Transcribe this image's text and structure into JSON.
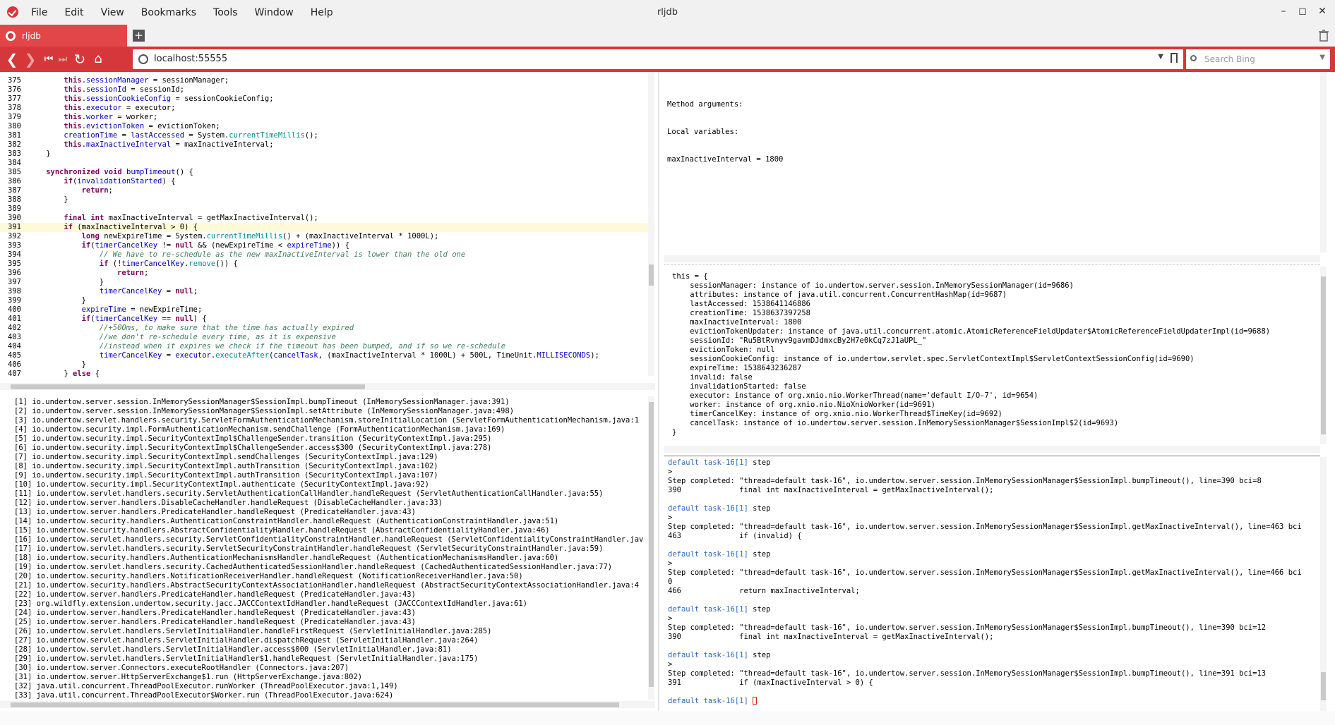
{
  "window": {
    "title": "rljdb"
  },
  "menu": [
    "File",
    "Edit",
    "View",
    "Bookmarks",
    "Tools",
    "Window",
    "Help"
  ],
  "tab": {
    "title": "rljdb"
  },
  "address": {
    "url": "localhost:55555",
    "search_placeholder": "Search Bing"
  },
  "code": {
    "highlight_line": 391,
    "lines": [
      {
        "n": "375",
        "html": "<span class=\"kw\">this</span>.<span class=\"fld\">sessionManager</span> = sessionManager;",
        "indent": 8
      },
      {
        "n": "376",
        "html": "<span class=\"kw\">this</span>.<span class=\"fld\">sessionId</span> = sessionId;",
        "indent": 8
      },
      {
        "n": "377",
        "html": "<span class=\"kw\">this</span>.<span class=\"fld\">sessionCookieConfig</span> = sessionCookieConfig;",
        "indent": 8
      },
      {
        "n": "378",
        "html": "<span class=\"kw\">this</span>.<span class=\"fld\">executor</span> = executor;",
        "indent": 8
      },
      {
        "n": "379",
        "html": "<span class=\"kw\">this</span>.<span class=\"fld\">worker</span> = worker;",
        "indent": 8
      },
      {
        "n": "380",
        "html": "<span class=\"kw\">this</span>.<span class=\"fld\">evictionToken</span> = evictionToken;",
        "indent": 8
      },
      {
        "n": "381",
        "html": "<span class=\"fld\">creationTime</span> = <span class=\"fld\">lastAccessed</span> = System.<span class=\"mt\">currentTimeMillis</span>();",
        "indent": 8
      },
      {
        "n": "382",
        "html": "<span class=\"kw\">this</span>.<span class=\"fld\">maxInactiveInterval</span> = maxInactiveInterval;",
        "indent": 8
      },
      {
        "n": "383",
        "html": "}",
        "indent": 4
      },
      {
        "n": "384",
        "html": "",
        "indent": 0
      },
      {
        "n": "385",
        "html": "<span class=\"kw\">synchronized</span> <span class=\"kw\">void</span> <span class=\"fld\">bumpTimeout</span>() {",
        "indent": 4
      },
      {
        "n": "386",
        "html": "<span class=\"kw\">if</span>(<span class=\"fld\">invalidationStarted</span>) {",
        "indent": 8
      },
      {
        "n": "387",
        "html": "<span class=\"kw\">return</span>;",
        "indent": 12
      },
      {
        "n": "388",
        "html": "}",
        "indent": 8
      },
      {
        "n": "389",
        "html": "",
        "indent": 0
      },
      {
        "n": "390",
        "html": "<span class=\"kw\">final</span> <span class=\"kw\">int</span> maxInactiveInterval = getMaxInactiveInterval();",
        "indent": 8
      },
      {
        "n": "391",
        "html": "<span class=\"kw\">if</span> (maxInactiveInterval &gt; 0) {",
        "indent": 8
      },
      {
        "n": "392",
        "html": "<span class=\"kw\">long</span> newExpireTime = System.<span class=\"mt\">currentTimeMillis</span>() + (maxInactiveInterval * 1000L);",
        "indent": 12
      },
      {
        "n": "393",
        "html": "<span class=\"kw\">if</span>(<span class=\"fld\">timerCancelKey</span> != <span class=\"kw\">null</span> &amp;&amp; (newExpireTime &lt; <span class=\"fld\">expireTime</span>)) {",
        "indent": 12
      },
      {
        "n": "394",
        "html": "<span class=\"cm\">// We have to re-schedule as the new maxInactiveInterval is lower than the old one</span>",
        "indent": 16
      },
      {
        "n": "395",
        "html": "<span class=\"kw\">if</span> (!<span class=\"fld\">timerCancelKey</span>.<span class=\"mt\">remove</span>()) {",
        "indent": 16
      },
      {
        "n": "396",
        "html": "<span class=\"kw\">return</span>;",
        "indent": 20
      },
      {
        "n": "397",
        "html": "}",
        "indent": 16
      },
      {
        "n": "398",
        "html": "<span class=\"fld\">timerCancelKey</span> = <span class=\"kw\">null</span>;",
        "indent": 16
      },
      {
        "n": "399",
        "html": "}",
        "indent": 12
      },
      {
        "n": "400",
        "html": "<span class=\"fld\">expireTime</span> = newExpireTime;",
        "indent": 12
      },
      {
        "n": "401",
        "html": "<span class=\"kw\">if</span>(<span class=\"fld\">timerCancelKey</span> == <span class=\"kw\">null</span>) {",
        "indent": 12
      },
      {
        "n": "402",
        "html": "<span class=\"cm\">//+500ms, to make sure that the time has actually expired</span>",
        "indent": 16
      },
      {
        "n": "403",
        "html": "<span class=\"cm\">//we don't re-schedule every time, as it is expensive</span>",
        "indent": 16
      },
      {
        "n": "404",
        "html": "<span class=\"cm\">//instead when it expires we check if the timeout has been bumped, and if so we re-schedule</span>",
        "indent": 16
      },
      {
        "n": "405",
        "html": "<span class=\"fld\">timerCancelKey</span> = <span class=\"fld\">executor</span>.<span class=\"mt\">executeAfter</span>(<span class=\"fld\">cancelTask</span>, (maxInactiveInterval * 1000L) + 500L, TimeUnit.<span class=\"fld\">MILLISECONDS</span>);",
        "indent": 16
      },
      {
        "n": "406",
        "html": "}",
        "indent": 12
      },
      {
        "n": "407",
        "html": "} <span class=\"kw\">else</span> {",
        "indent": 8
      }
    ]
  },
  "args": {
    "lines": [
      "Method arguments:",
      "Local variables:",
      "maxInactiveInterval = 1800"
    ]
  },
  "this_obj": {
    "lines": [
      "this = {",
      "    sessionManager: instance of io.undertow.server.session.InMemorySessionManager(id=9686)",
      "    attributes: instance of java.util.concurrent.ConcurrentHashMap(id=9687)",
      "    lastAccessed: 1538641146886",
      "    creationTime: 1538637397258",
      "    maxInactiveInterval: 1800",
      "    evictionTokenUpdater: instance of java.util.concurrent.atomic.AtomicReferenceFieldUpdater$AtomicReferenceFieldUpdaterImpl(id=9688)",
      "    sessionId: \"Ru5BtRvnyv9gavmDJdmxcBy2H7e0kCq7zJ1aUPL_\"",
      "    evictionToken: null",
      "    sessionCookieConfig: instance of io.undertow.servlet.spec.ServletContextImpl$ServletContextSessionConfig(id=9690)",
      "    expireTime: 1538643236287",
      "    invalid: false",
      "    invalidationStarted: false",
      "    executor: instance of org.xnio.nio.WorkerThread(name='default I/O-7', id=9654)",
      "    worker: instance of org.xnio.nio.NioXnioWorker(id=9691)",
      "    timerCancelKey: instance of org.xnio.nio.WorkerThread$TimeKey(id=9692)",
      "    cancelTask: instance of io.undertow.server.session.InMemorySessionManager$SessionImpl$2(id=9693)",
      "}"
    ]
  },
  "stack": {
    "lines": [
      "[1] io.undertow.server.session.InMemorySessionManager$SessionImpl.bumpTimeout (InMemorySessionManager.java:391)",
      "[2] io.undertow.server.session.InMemorySessionManager$SessionImpl.setAttribute (InMemorySessionManager.java:498)",
      "[3] io.undertow.servlet.handlers.security.ServletFormAuthenticationMechanism.storeInitialLocation (ServletFormAuthenticationMechanism.java:1",
      "[4] io.undertow.security.impl.FormAuthenticationMechanism.sendChallenge (FormAuthenticationMechanism.java:169)",
      "[5] io.undertow.security.impl.SecurityContextImpl$ChallengeSender.transition (SecurityContextImpl.java:295)",
      "[6] io.undertow.security.impl.SecurityContextImpl$ChallengeSender.access$300 (SecurityContextImpl.java:278)",
      "[7] io.undertow.security.impl.SecurityContextImpl.sendChallenges (SecurityContextImpl.java:129)",
      "[8] io.undertow.security.impl.SecurityContextImpl.authTransition (SecurityContextImpl.java:102)",
      "[9] io.undertow.security.impl.SecurityContextImpl.authTransition (SecurityContextImpl.java:107)",
      "[10] io.undertow.security.impl.SecurityContextImpl.authenticate (SecurityContextImpl.java:92)",
      "[11] io.undertow.servlet.handlers.security.ServletAuthenticationCallHandler.handleRequest (ServletAuthenticationCallHandler.java:55)",
      "[12] io.undertow.server.handlers.DisableCacheHandler.handleRequest (DisableCacheHandler.java:33)",
      "[13] io.undertow.server.handlers.PredicateHandler.handleRequest (PredicateHandler.java:43)",
      "[14] io.undertow.security.handlers.AuthenticationConstraintHandler.handleRequest (AuthenticationConstraintHandler.java:51)",
      "[15] io.undertow.security.handlers.AbstractConfidentialityHandler.handleRequest (AbstractConfidentialityHandler.java:46)",
      "[16] io.undertow.servlet.handlers.security.ServletConfidentialityConstraintHandler.handleRequest (ServletConfidentialityConstraintHandler.jav",
      "[17] io.undertow.servlet.handlers.security.ServletSecurityConstraintHandler.handleRequest (ServletSecurityConstraintHandler.java:59)",
      "[18] io.undertow.security.handlers.AuthenticationMechanismsHandler.handleRequest (AuthenticationMechanismsHandler.java:60)",
      "[19] io.undertow.servlet.handlers.security.CachedAuthenticatedSessionHandler.handleRequest (CachedAuthenticatedSessionHandler.java:77)",
      "[20] io.undertow.security.handlers.NotificationReceiverHandler.handleRequest (NotificationReceiverHandler.java:50)",
      "[21] io.undertow.security.handlers.AbstractSecurityContextAssociationHandler.handleRequest (AbstractSecurityContextAssociationHandler.java:4",
      "[22] io.undertow.server.handlers.PredicateHandler.handleRequest (PredicateHandler.java:43)",
      "[23] org.wildfly.extension.undertow.security.jacc.JACCContextIdHandler.handleRequest (JACCContextIdHandler.java:61)",
      "[24] io.undertow.server.handlers.PredicateHandler.handleRequest (PredicateHandler.java:43)",
      "[25] io.undertow.server.handlers.PredicateHandler.handleRequest (PredicateHandler.java:43)",
      "[26] io.undertow.servlet.handlers.ServletInitialHandler.handleFirstRequest (ServletInitialHandler.java:285)",
      "[27] io.undertow.servlet.handlers.ServletInitialHandler.dispatchRequest (ServletInitialHandler.java:264)",
      "[28] io.undertow.servlet.handlers.ServletInitialHandler.access$000 (ServletInitialHandler.java:81)",
      "[29] io.undertow.servlet.handlers.ServletInitialHandler$1.handleRequest (ServletInitialHandler.java:175)",
      "[30] io.undertow.server.Connectors.executeRootHandler (Connectors.java:207)",
      "[31] io.undertow.server.HttpServerExchange$1.run (HttpServerExchange.java:802)",
      "[32] java.util.concurrent.ThreadPoolExecutor.runWorker (ThreadPoolExecutor.java:1,149)",
      "[33] java.util.concurrent.ThreadPoolExecutor$Worker.run (ThreadPoolExecutor.java:624)"
    ]
  },
  "console": {
    "prompt": "default task-16[1]",
    "entries": [
      {
        "cmd": "step",
        "out": [
          ">",
          "Step completed: \"thread=default task-16\", io.undertow.server.session.InMemorySessionManager$SessionImpl.bumpTimeout(), line=390 bci=8",
          "390             final int maxInactiveInterval = getMaxInactiveInterval();",
          ""
        ]
      },
      {
        "cmd": "step",
        "out": [
          ">",
          "Step completed: \"thread=default task-16\", io.undertow.server.session.InMemorySessionManager$SessionImpl.getMaxInactiveInterval(), line=463 bci",
          "463             if (invalid) {",
          ""
        ]
      },
      {
        "cmd": "step",
        "out": [
          ">",
          "Step completed: \"thread=default task-16\", io.undertow.server.session.InMemorySessionManager$SessionImpl.getMaxInactiveInterval(), line=466 bci",
          "0",
          "466             return maxInactiveInterval;",
          ""
        ]
      },
      {
        "cmd": "step",
        "out": [
          ">",
          "Step completed: \"thread=default task-16\", io.undertow.server.session.InMemorySessionManager$SessionImpl.bumpTimeout(), line=390 bci=12",
          "390             final int maxInactiveInterval = getMaxInactiveInterval();",
          ""
        ]
      },
      {
        "cmd": "step",
        "out": [
          ">",
          "Step completed: \"thread=default task-16\", io.undertow.server.session.InMemorySessionManager$SessionImpl.bumpTimeout(), line=391 bci=13",
          "391             if (maxInactiveInterval > 0) {",
          ""
        ]
      }
    ]
  },
  "colors": {
    "accent": "#d6373a",
    "tab": "#e34649",
    "prompt": "#2f67c2",
    "highlight": "#fdfad8"
  },
  "icons": [
    "app-logo-icon",
    "back-icon",
    "forward-icon",
    "rewind-icon",
    "fast-forward-icon",
    "reload-icon",
    "home-icon",
    "globe-icon",
    "bookmark-icon",
    "search-icon",
    "trash-icon",
    "new-tab-icon"
  ]
}
